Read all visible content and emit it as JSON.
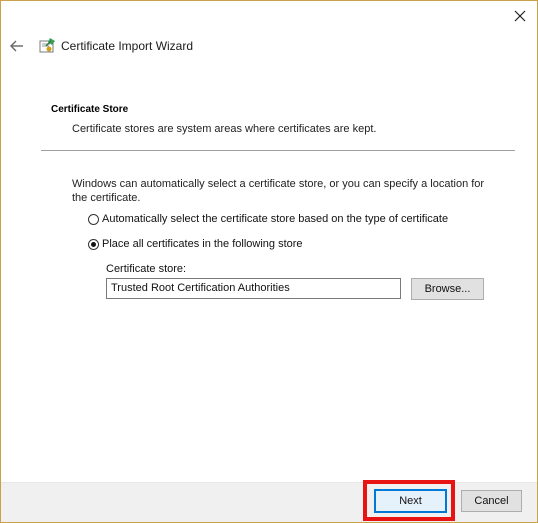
{
  "window": {
    "title": "Certificate Import Wizard",
    "close_icon": "close-icon",
    "back_icon": "back-arrow-icon",
    "wizard_icon": "certificate-wizard-icon"
  },
  "section": {
    "heading": "Certificate Store",
    "description": "Certificate stores are system areas where certificates are kept."
  },
  "body": {
    "intro": "Windows can automatically select a certificate store, or you can specify a location for the certificate.",
    "options": [
      {
        "label": "Automatically select the certificate store based on the type of certificate",
        "selected": false
      },
      {
        "label": "Place all certificates in the following store",
        "selected": true
      }
    ],
    "store_label": "Certificate store:",
    "store_value": "Trusted Root Certification Authorities",
    "browse_label": "Browse..."
  },
  "footer": {
    "next_label": "Next",
    "cancel_label": "Cancel",
    "highlight_color": "#e81313"
  }
}
